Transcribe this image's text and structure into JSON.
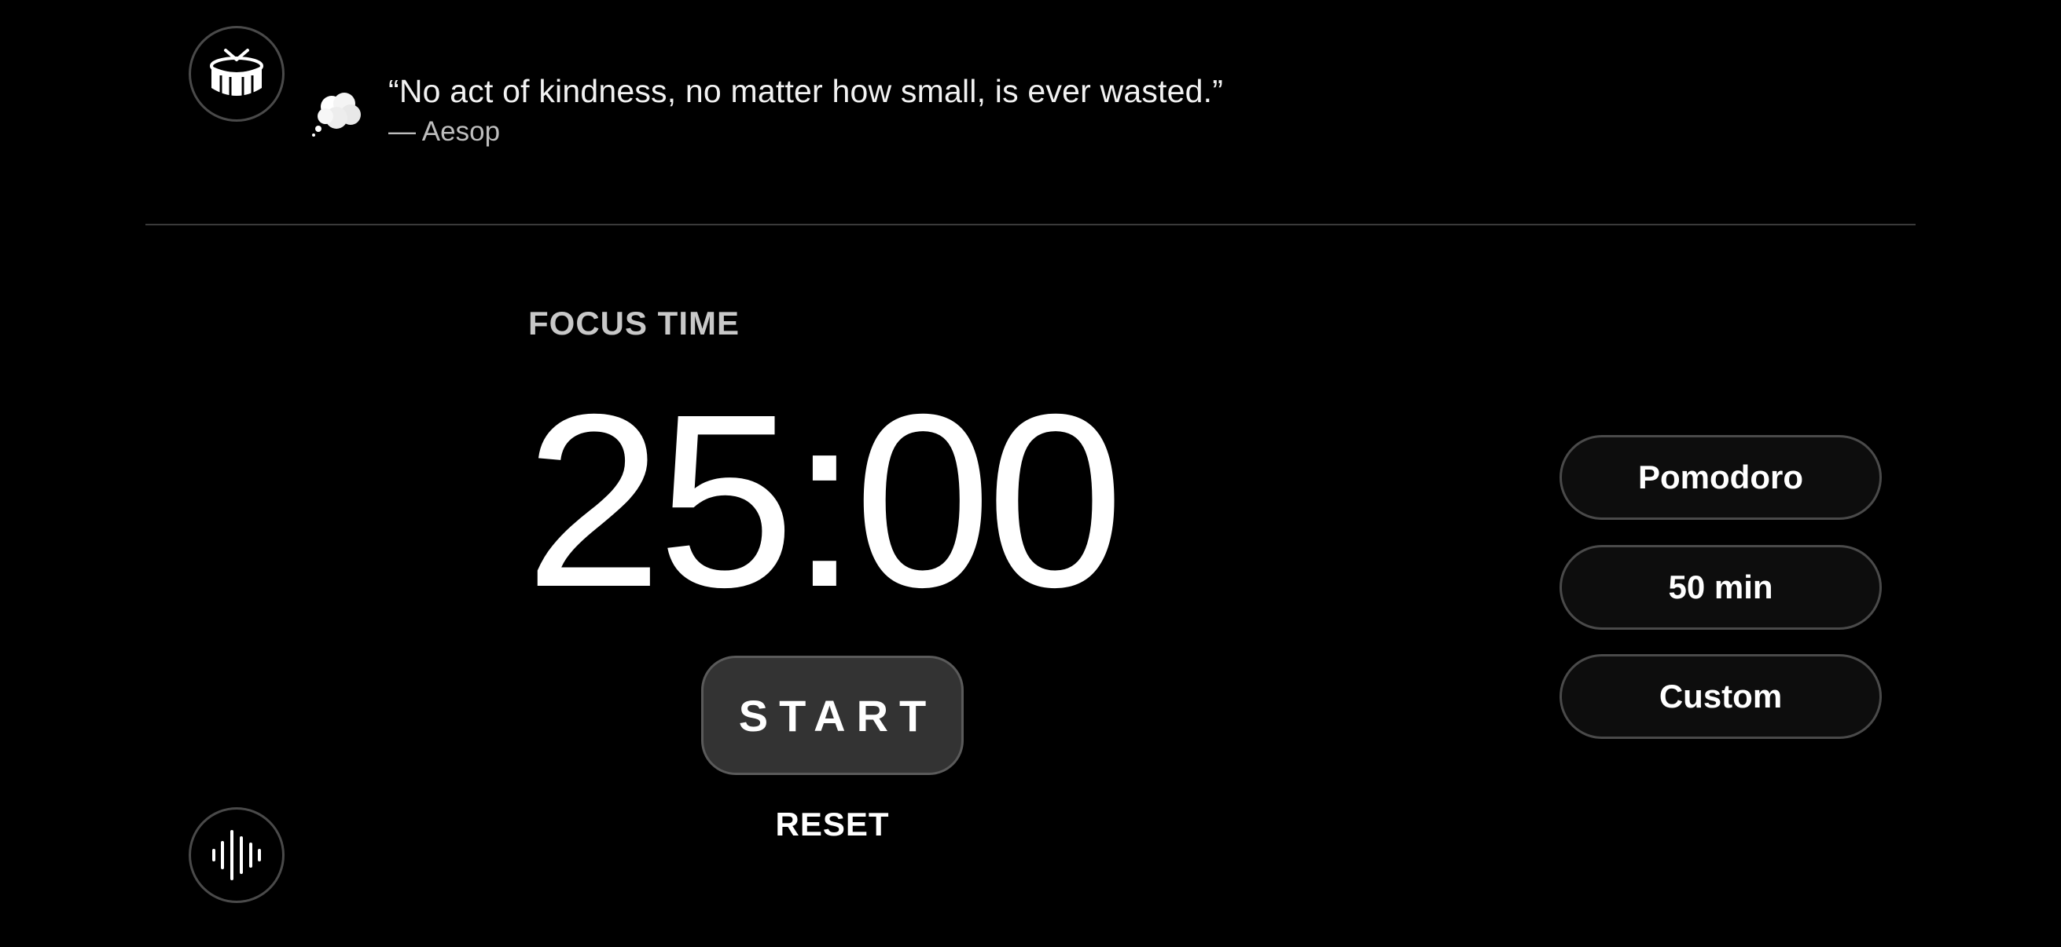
{
  "quote": {
    "text": "“No act of kindness, no matter how small, is ever wasted.”",
    "author": "— Aesop"
  },
  "timer": {
    "label": "FOCUS TIME",
    "display": "25:00",
    "start_label": "START",
    "reset_label": "RESET"
  },
  "presets": [
    {
      "label": "Pomodoro"
    },
    {
      "label": "50 min"
    },
    {
      "label": "Custom"
    }
  ],
  "icons": {
    "top_left": "drum-icon",
    "quote_bubble": "thought-bubble-icon",
    "bottom_left": "sound-wave-icon"
  },
  "colors": {
    "background": "#000000",
    "text": "#ffffff",
    "muted": "#c8c8c8",
    "start_button_bg": "#333333",
    "preset_button_bg": "#0d0d0d",
    "border": "#4a4a4a"
  }
}
